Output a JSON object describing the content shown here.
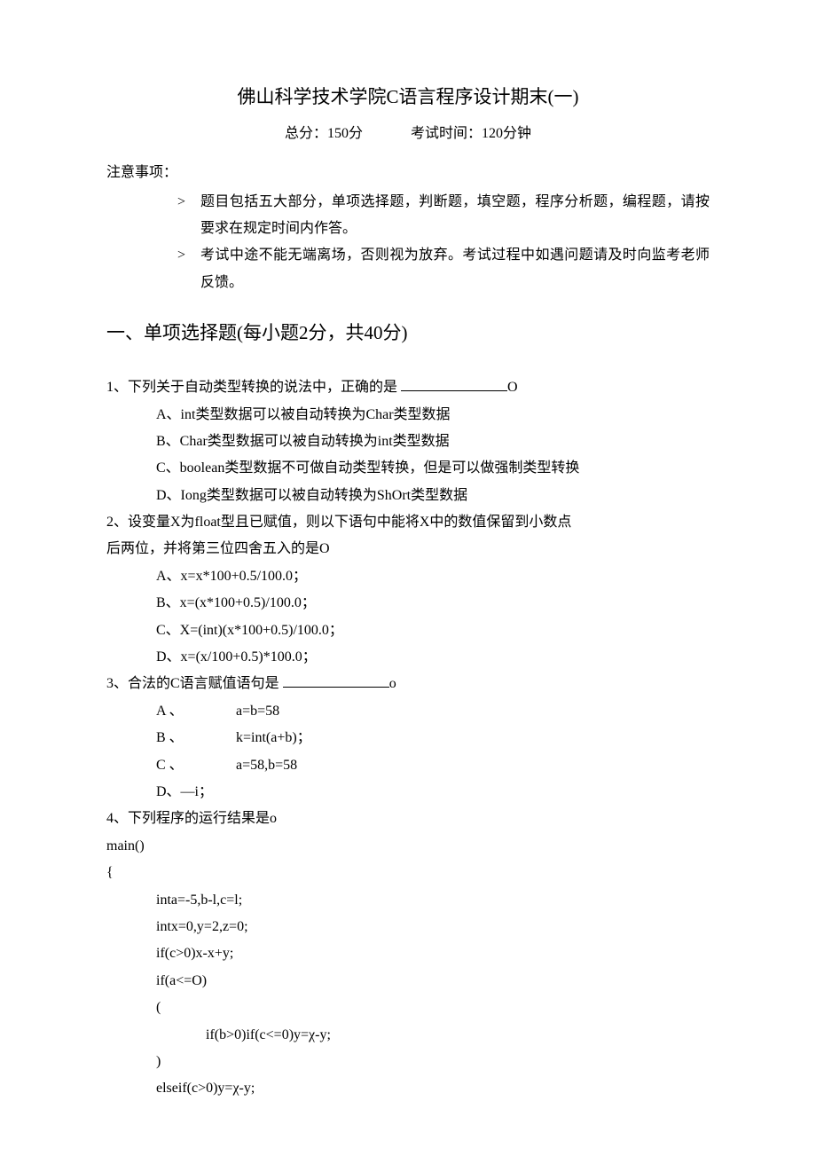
{
  "title": "佛山科学技术学院C语言程序设计期末(一)",
  "subtitle_left": "总分：150分",
  "subtitle_right": "考试时间：120分钟",
  "notice_label": "注意事项：",
  "notices": [
    "题目包括五大部分，单项选择题，判断题，填空题，程序分析题，编程题，请按要求在规定时间内作答。",
    "考试中途不能无端离场，否则视为放弃。考试过程中如遇问题请及时向监考老师反馈。"
  ],
  "section1_heading": "一、单项选择题(每小题2分，共40分)",
  "q1": {
    "stem_pre": "1、下列关于自动类型转换的说法中，正确的是 ",
    "stem_post": "O",
    "A": "A、int类型数据可以被自动转换为Char类型数据",
    "B": "B、Char类型数据可以被自动转换为int类型数据",
    "C": "C、boolean类型数据不可做自动类型转换，但是可以做强制类型转换",
    "D": "D、Iong类型数据可以被自动转换为ShOrt类型数据"
  },
  "q2": {
    "stem1": "2、设变量X为float型且已赋值，则以下语句中能将X中的数值保留到小数点",
    "stem2": "后两位，并将第三位四舍五入的是O",
    "A": "A、x=x*100+0.5/100.0；",
    "B": "B、x=(x*100+0.5)/100.0；",
    "C": "C、X=(int)(x*100+0.5)/100.0；",
    "D": "D、x=(x/100+0.5)*100.0；"
  },
  "q3": {
    "stem_pre": "3、合法的C语言赋值语句是 ",
    "stem_post": "o",
    "A_lbl": "A 、",
    "A_val": "a=b=58",
    "B_lbl": "B 、",
    "B_val": "k=int(a+b)；",
    "C_lbl": "C 、",
    "C_val": "a=58,b=58",
    "D": "D、—i；"
  },
  "q4": {
    "stem": "4、下列程序的运行结果是o",
    "code": [
      "main()",
      "{",
      "inta=-5,b-l,c=l;",
      "intx=0,y=2,z=0;",
      "if(c>0)x-x+y;",
      "if(a<=O)",
      "(",
      "if(b>0)if(c<=0)y=χ-y;",
      ")",
      "elseif(c>0)y=χ-y;"
    ]
  }
}
